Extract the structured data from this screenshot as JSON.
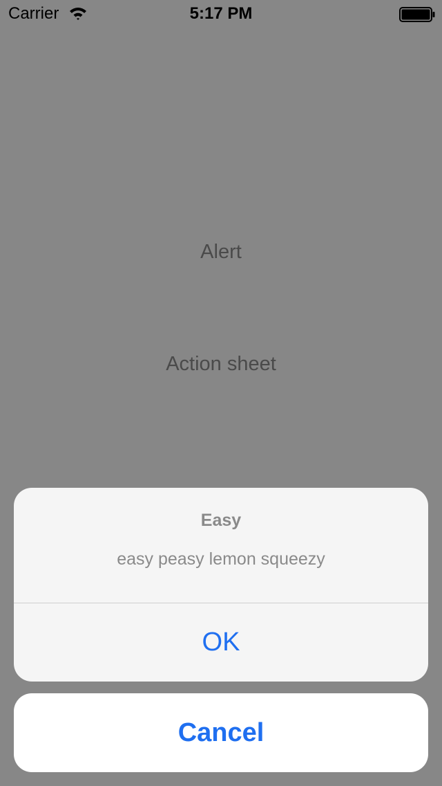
{
  "status_bar": {
    "carrier": "Carrier",
    "time": "5:17 PM",
    "wifi_icon": "wifi-icon",
    "battery_icon": "battery-full-icon"
  },
  "background": {
    "alert_label": "Alert",
    "action_sheet_label": "Action sheet"
  },
  "action_sheet": {
    "title": "Easy",
    "message": "easy peasy lemon squeezy",
    "ok_label": "OK",
    "cancel_label": "Cancel"
  },
  "colors": {
    "accent": "#1f6ff0",
    "dimmed_background": "#878787",
    "sheet_background": "#f5f5f5"
  }
}
